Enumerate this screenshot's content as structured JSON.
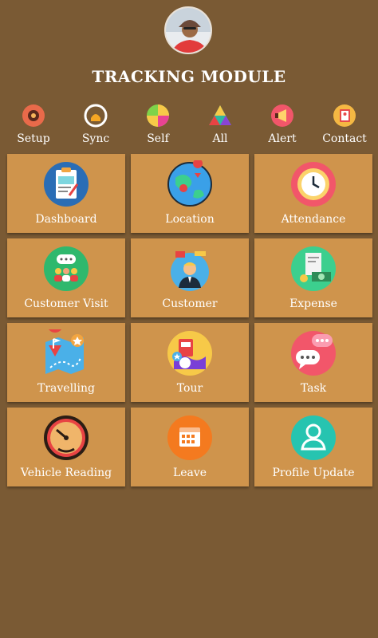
{
  "header": {
    "title": "TRACKING MODULE"
  },
  "top_actions": [
    {
      "label": "Setup",
      "icon": "gear-icon"
    },
    {
      "label": "Sync",
      "icon": "sync-icon"
    },
    {
      "label": "Self",
      "icon": "self-pie-icon"
    },
    {
      "label": "All",
      "icon": "all-triangle-icon"
    },
    {
      "label": "Alert",
      "icon": "megaphone-icon"
    },
    {
      "label": "Contact",
      "icon": "contact-book-icon"
    }
  ],
  "tiles": [
    {
      "label": "Dashboard",
      "icon": "clipboard-icon"
    },
    {
      "label": "Location",
      "icon": "globe-pin-icon"
    },
    {
      "label": "Attendance",
      "icon": "clock-icon"
    },
    {
      "label": "Customer Visit",
      "icon": "group-chat-icon"
    },
    {
      "label": "Customer",
      "icon": "customer-icon"
    },
    {
      "label": "Expense",
      "icon": "money-receipt-icon"
    },
    {
      "label": "Travelling",
      "icon": "map-route-icon"
    },
    {
      "label": "Tour",
      "icon": "tour-icon"
    },
    {
      "label": "Task",
      "icon": "chat-bubbles-icon"
    },
    {
      "label": "Vehicle Reading",
      "icon": "speedometer-icon"
    },
    {
      "label": "Leave",
      "icon": "calendar-icon"
    },
    {
      "label": "Profile Update",
      "icon": "profile-icon"
    }
  ]
}
